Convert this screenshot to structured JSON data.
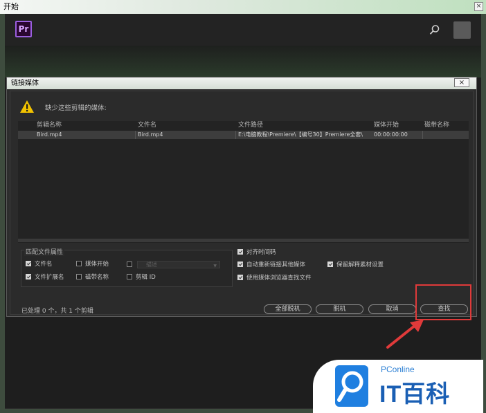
{
  "window": {
    "title": "开始",
    "close_glyph": "×"
  },
  "app": {
    "logo_text": "Pr"
  },
  "dialog": {
    "title": "链接媒体",
    "close_glyph": "×",
    "message": "缺少这些剪辑的媒体:",
    "table": {
      "headers": [
        "剪辑名称",
        "文件名",
        "文件路径",
        "媒体开始",
        "磁带名称"
      ],
      "rows": [
        [
          "Bird.mp4",
          "Bird.mp4",
          "E:\\电脑教程\\Premiere\\【编号30】Premiere全套\\",
          "00:00:00:00",
          ""
        ]
      ]
    },
    "match_group": {
      "title": "匹配文件属性",
      "options": [
        {
          "label": "文件名",
          "checked": true
        },
        {
          "label": "媒体开始",
          "checked": false
        },
        {
          "label": "",
          "checked": false
        },
        {
          "label": "文件扩展名",
          "checked": true
        },
        {
          "label": "磁带名称",
          "checked": false
        },
        {
          "label": "剪辑 ID",
          "checked": false
        }
      ],
      "dropdown_value": "描述"
    },
    "options": [
      {
        "label": "对齐时间码",
        "checked": true
      },
      {
        "label": "自动重新链接其他媒体",
        "checked": true
      },
      {
        "label": "保留解释素材设置",
        "checked": true
      },
      {
        "label": "使用媒体浏览器查找文件",
        "checked": true
      }
    ],
    "status": "已处理 0 个，共 1 个剪辑",
    "buttons": {
      "offline_all": "全部脱机",
      "offline": "脱机",
      "cancel": "取消",
      "locate": "查找"
    }
  },
  "watermark": {
    "brand": "PConline",
    "name": "IT百科"
  },
  "colors": {
    "highlight": "#e03a3a",
    "accent": "#9b5fe0"
  }
}
